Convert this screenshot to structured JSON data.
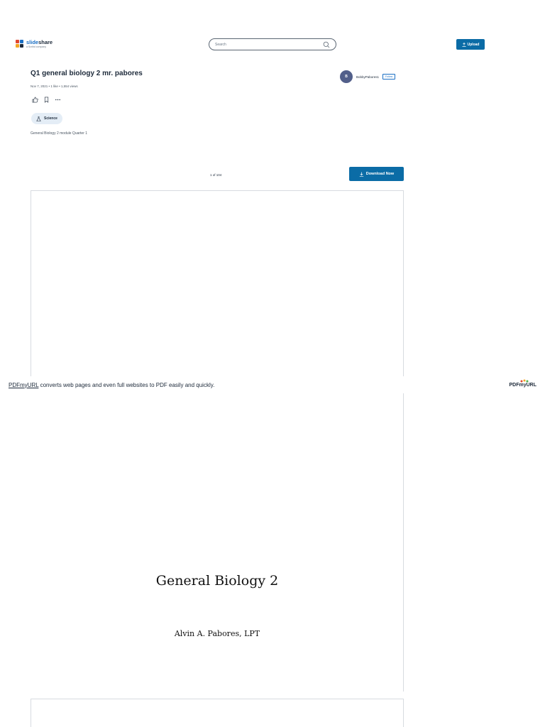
{
  "header": {
    "logo_name_a": "slide",
    "logo_name_b": "share",
    "logo_sub": "a Scribd company",
    "search_placeholder": "Search",
    "upload_label": "Upload"
  },
  "document": {
    "title": "Q1 general biology 2 mr. pabores",
    "meta": "Nov 7, 2021 • 1 like • 1,554 views",
    "category": "Science",
    "description": "General Biology 2 module Quarter 1"
  },
  "author": {
    "initial": "B",
    "name": "BobbyPabores1",
    "follow_label": "Follow"
  },
  "viewer": {
    "page_count": "1 of 104",
    "download_label": "Download Now"
  },
  "slide": {
    "title": "General Biology 2",
    "author": "Alvin A. Pabores, LPT"
  },
  "banner": {
    "link_text": "PDFmyURL",
    "text": " converts web pages and even full websites to PDF easily and quickly.",
    "logo_text": "PDFmyURL"
  },
  "colors": {
    "brand": "#0b6ca6",
    "chip_bg": "#e4edf6",
    "avatar_bg": "#525f8a"
  }
}
